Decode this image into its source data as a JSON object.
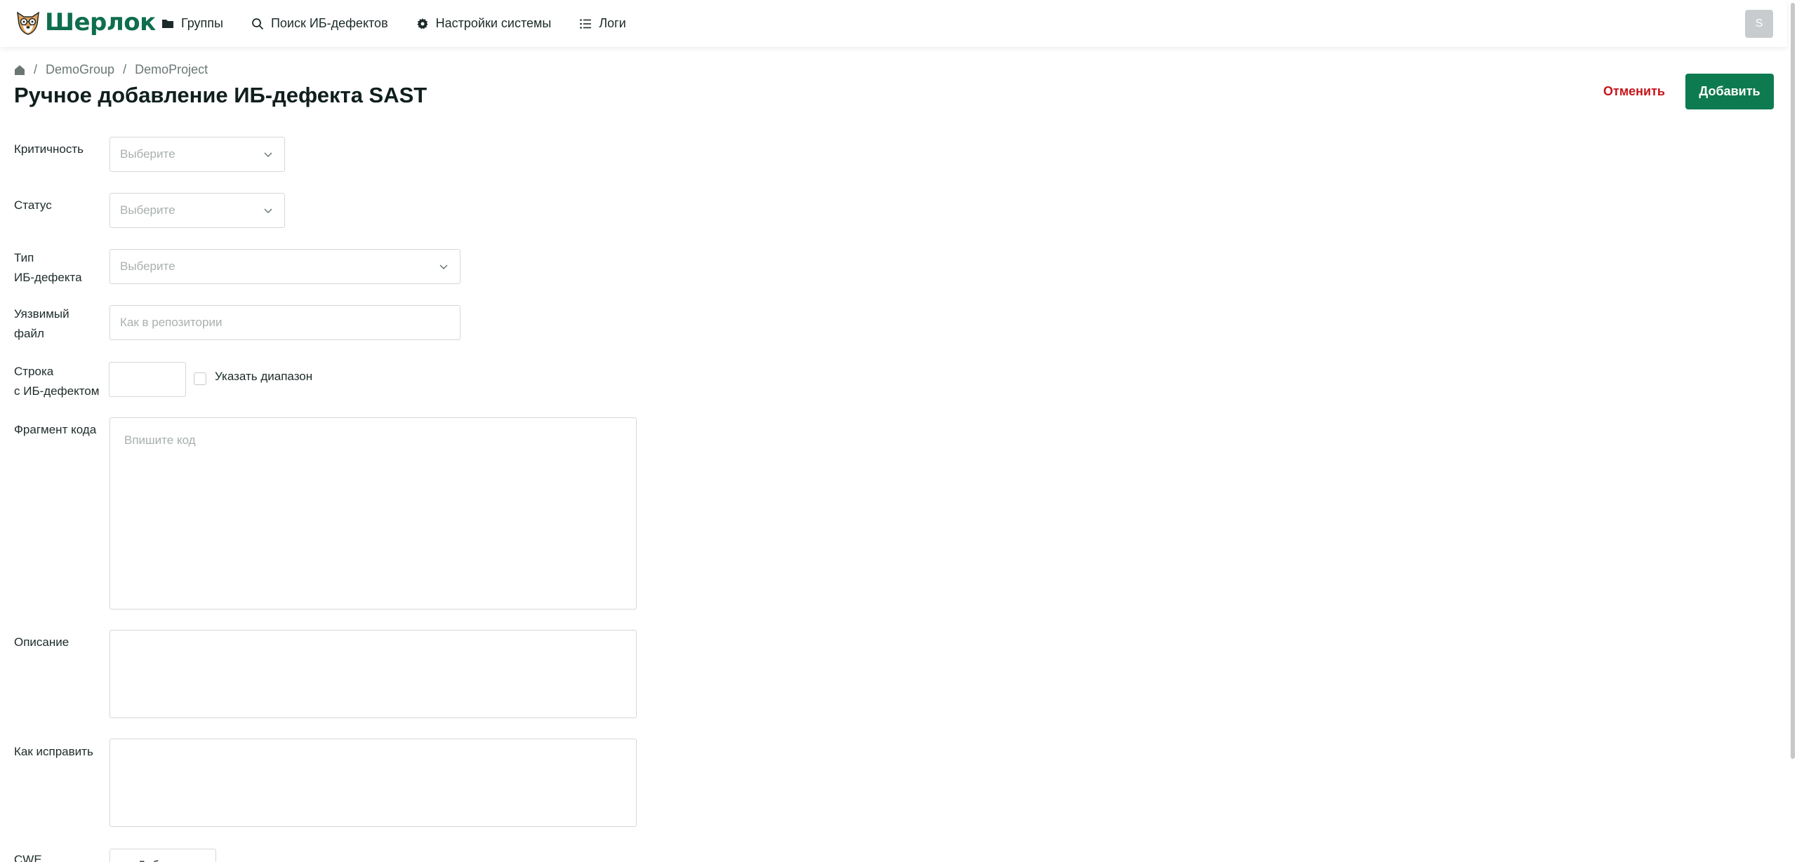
{
  "app": {
    "name": "Шерлок"
  },
  "nav": {
    "groups": "Группы",
    "search": "Поиск ИБ-дефектов",
    "settings": "Настройки системы",
    "logs": "Логи"
  },
  "user": {
    "initial": "S"
  },
  "breadcrumb": {
    "group": "DemoGroup",
    "project": "DemoProject"
  },
  "page": {
    "title": "Ручное добавление ИБ-дефекта SAST"
  },
  "actions": {
    "cancel": "Отменить",
    "add": "Добавить"
  },
  "form": {
    "severity": {
      "label": "Критичность",
      "placeholder": "Выберите"
    },
    "status": {
      "label": "Статус",
      "placeholder": "Выберите"
    },
    "type": {
      "label_line1": "Тип",
      "label_line2": "ИБ-дефекта",
      "placeholder": "Выберите"
    },
    "file": {
      "label_line1": "Уязвимый",
      "label_line2": "файл",
      "placeholder": "Как в репозитории"
    },
    "line": {
      "label_line1": "Строка",
      "label_line2": "с ИБ-дефектом",
      "value": "",
      "range_label": "Указать диапазон",
      "range_checked": false
    },
    "code": {
      "label": "Фрагмент кода",
      "placeholder": "Впишите код"
    },
    "description": {
      "label": "Описание",
      "value": ""
    },
    "fix": {
      "label": "Как исправить",
      "value": ""
    },
    "cwe": {
      "label": "CWE",
      "button": "+ Добавить"
    }
  },
  "colors": {
    "brand": "#0e6e4e",
    "primary_button": "#0e7a50",
    "cancel": "#c6161c"
  }
}
